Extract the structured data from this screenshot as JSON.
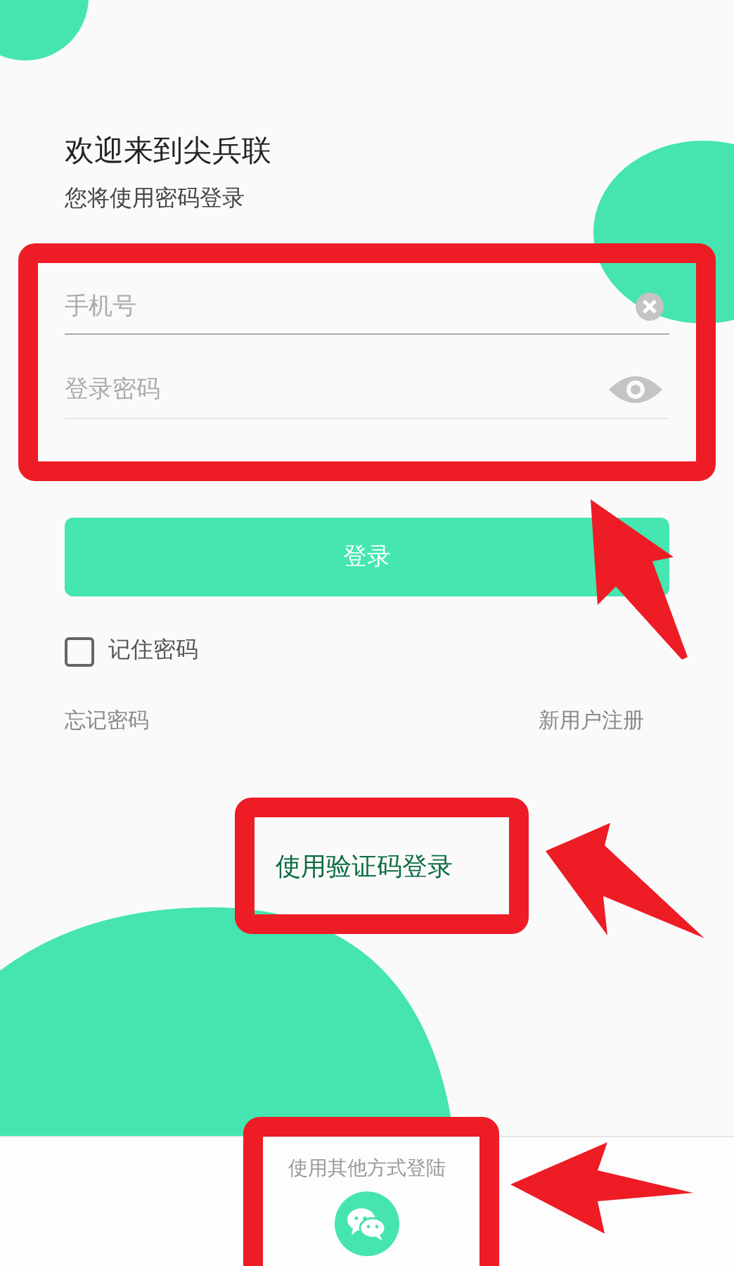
{
  "title": "欢迎来到尖兵联",
  "subtitle": "您将使用密码登录",
  "fields": [
    {
      "kind": "phone",
      "placeholder": "手机号"
    },
    {
      "kind": "password",
      "placeholder": "登录密码"
    }
  ],
  "login_button": "登录",
  "remember": {
    "label": "记住密码",
    "checked": false
  },
  "links": {
    "forgot": "忘记密码",
    "register": "新用户注册"
  },
  "sms_login": "使用验证码登录",
  "other_login": {
    "label": "使用其他方式登陆"
  }
}
